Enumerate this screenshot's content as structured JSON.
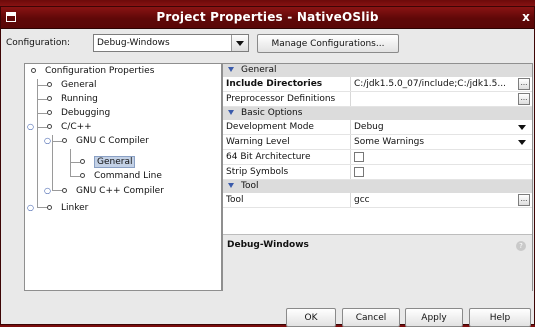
{
  "window": {
    "title": "Project Properties - NativeOSlib",
    "close_glyph": "x"
  },
  "configuration": {
    "label": "Configuration:",
    "selected": "Debug-Windows",
    "manage_button": "Manage Configurations..."
  },
  "tree": {
    "root": "Configuration Properties",
    "items": {
      "general": "General",
      "running": "Running",
      "debugging": "Debugging",
      "cc": "C/C++",
      "gnu_c": "GNU C Compiler",
      "gnu_c_general": "General",
      "command_line": "Command Line",
      "gnu_cpp": "GNU C++ Compiler",
      "linker": "Linker"
    },
    "selected": "General"
  },
  "properties": {
    "cat_general": "General",
    "include_dirs_label": "Include Directories",
    "include_dirs_value": "C:/jdk1.5.0_07/include;C:/jdk1.5...",
    "preproc_label": "Preprocessor Definitions",
    "preproc_value": "",
    "cat_basic": "Basic Options",
    "dev_mode_label": "Development Mode",
    "dev_mode_value": "Debug",
    "warning_label": "Warning Level",
    "warning_value": "Some Warnings",
    "arch64_label": "64 Bit Architecture",
    "strip_label": "Strip Symbols",
    "cat_tool": "Tool",
    "tool_label": "Tool",
    "tool_value": "gcc",
    "ellipsis": "..."
  },
  "description": {
    "title": "Debug-Windows"
  },
  "buttons": {
    "ok": "OK",
    "cancel": "Cancel",
    "apply": "Apply",
    "help": "Help"
  }
}
